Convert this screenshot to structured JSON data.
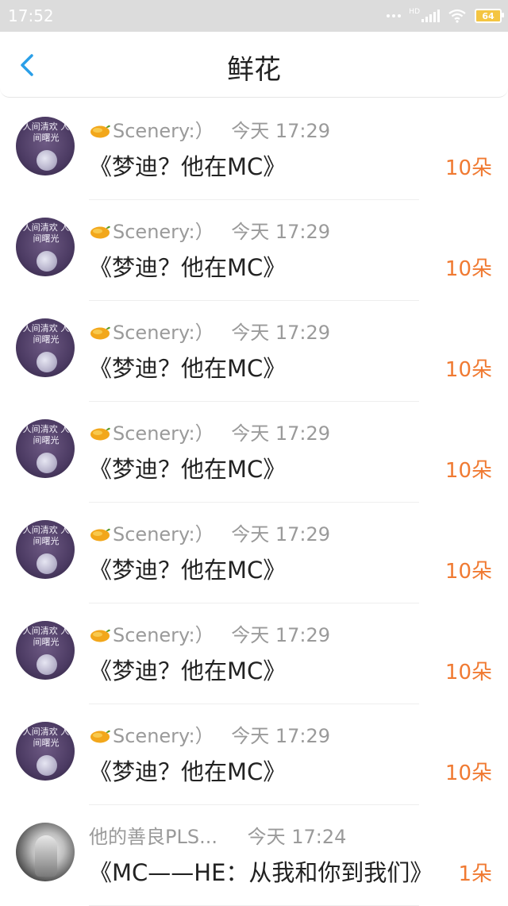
{
  "status_bar": {
    "time": "17:52",
    "battery": "64",
    "network_label": "HD"
  },
  "header": {
    "title": "鲜花"
  },
  "colors": {
    "accent_blue": "#2a9fe8",
    "count_orange": "#f07a32"
  },
  "items": [
    {
      "sender": "Scenery:）",
      "time": "今天 17:29",
      "message": "《梦迪？他在MC》",
      "count": "10朵",
      "avatar_text": "人间清欢 人间曙光"
    },
    {
      "sender": "Scenery:）",
      "time": "今天 17:29",
      "message": "《梦迪？他在MC》",
      "count": "10朵",
      "avatar_text": "人间清欢 人间曙光"
    },
    {
      "sender": "Scenery:）",
      "time": "今天 17:29",
      "message": "《梦迪？他在MC》",
      "count": "10朵",
      "avatar_text": "人间清欢 人间曙光"
    },
    {
      "sender": "Scenery:）",
      "time": "今天 17:29",
      "message": "《梦迪？他在MC》",
      "count": "10朵",
      "avatar_text": "人间清欢 人间曙光"
    },
    {
      "sender": "Scenery:）",
      "time": "今天 17:29",
      "message": "《梦迪？他在MC》",
      "count": "10朵",
      "avatar_text": "人间清欢 人间曙光"
    },
    {
      "sender": "Scenery:）",
      "time": "今天 17:29",
      "message": "《梦迪？他在MC》",
      "count": "10朵",
      "avatar_text": "人间清欢 人间曙光"
    },
    {
      "sender": "Scenery:）",
      "time": "今天 17:29",
      "message": "《梦迪？他在MC》",
      "count": "10朵",
      "avatar_text": "人间清欢 人间曙光"
    },
    {
      "sender": "他的善良PLS...",
      "time": "今天 17:24",
      "message": "《MC——HE：从我和你到我们》",
      "count": "1朵",
      "avatar_text": ""
    }
  ]
}
